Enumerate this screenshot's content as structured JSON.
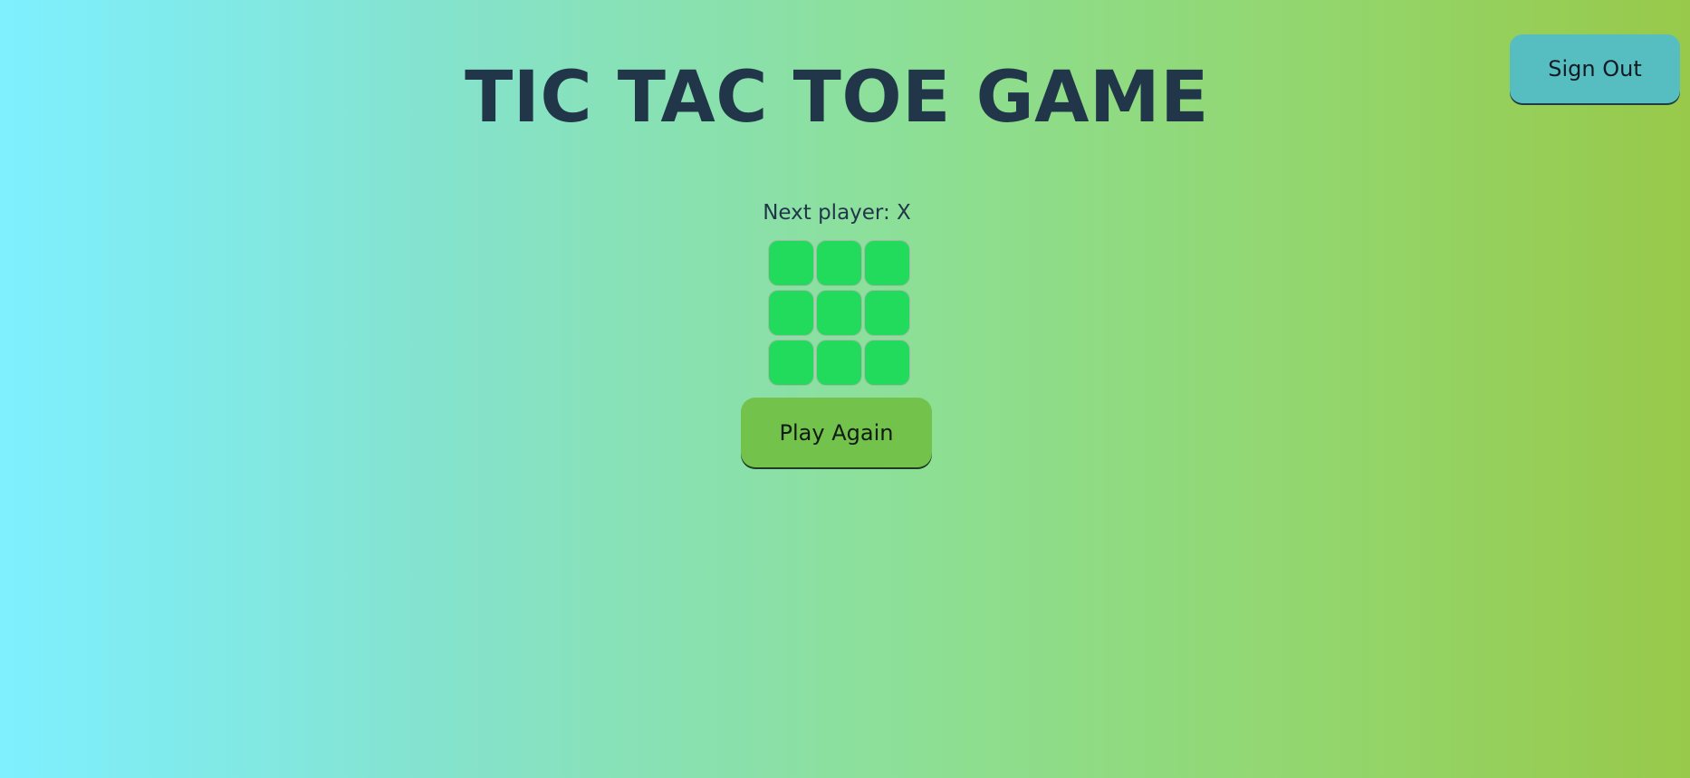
{
  "header": {
    "title": "TIC TAC TOE GAME",
    "sign_out_label": "Sign Out"
  },
  "game": {
    "status": "Next player: X",
    "board": [
      "",
      "",
      "",
      "",
      "",
      "",
      "",
      "",
      ""
    ],
    "play_again_label": "Play Again"
  },
  "colors": {
    "background_start": "#7ef0ff",
    "background_end": "#98c94a",
    "square": "#22db5c",
    "play_again_button": "#72c24c",
    "sign_out_button": "#56bec1",
    "text": "#22364a"
  }
}
